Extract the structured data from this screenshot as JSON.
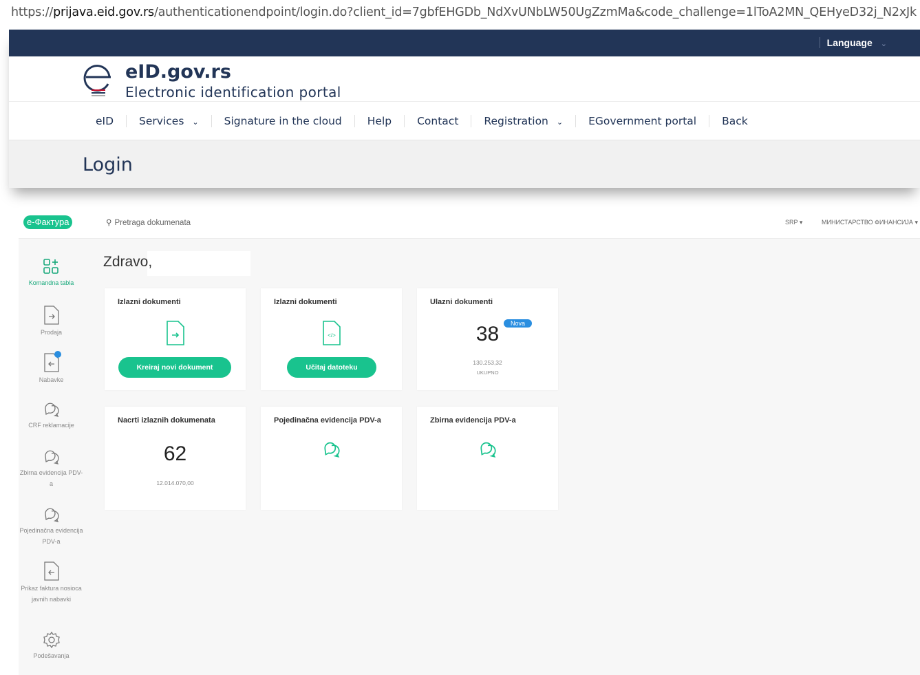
{
  "url": {
    "prefix": "https://",
    "domain": "prijava.eid.gov.rs",
    "rest": "/authenticationendpoint/login.do?client_id=7gbfEHGDb_NdXvUNbLW50UgZzmMa&code_challenge=1lToA2MN_QEHyeD32j_N2xJk"
  },
  "eid": {
    "language_label": "Language",
    "title": "eID.gov.rs",
    "subtitle": "Electronic identification portal",
    "nav": [
      "eID",
      "Services",
      "Signature in the cloud",
      "Help",
      "Contact",
      "Registration",
      "EGovernment portal",
      "Back"
    ],
    "page_title": "Login",
    "colors": {
      "navy": "#223557"
    }
  },
  "efaktura": {
    "logo_text": "е-Фактура",
    "search_placeholder": "Pretraga dokumenata",
    "lang": "SRP",
    "org": "МИНИСТАРСТВО ФИНАНСИЈА",
    "greeting": "Zdravo,",
    "sidebar": [
      {
        "label": "Komandna tabla",
        "icon": "dashboard-icon"
      },
      {
        "label": "Prodaja",
        "icon": "document-out-icon"
      },
      {
        "label": "Nabavke",
        "icon": "document-in-icon"
      },
      {
        "label": "CRF reklamacije",
        "icon": "chat-icon"
      },
      {
        "label": "Zbirna evidencija PDV-a",
        "icon": "chat-icon"
      },
      {
        "label": "Pojedinačna evidencija PDV-a",
        "icon": "chat-icon"
      },
      {
        "label": "Prikaz faktura nosioca javnih nabavki",
        "icon": "document-in-icon"
      },
      {
        "label": "Podešavanja",
        "icon": "gear-icon"
      }
    ],
    "cards": {
      "c1": {
        "title": "Izlazni dokumenti",
        "button": "Kreiraj novi dokument"
      },
      "c2": {
        "title": "Izlazni dokumenti",
        "button": "Učitaj datoteku"
      },
      "c3": {
        "title": "Ulazni dokumenti",
        "count": "38",
        "badge": "Nova",
        "amount": "130.253,32",
        "total_label": "UKUPNO"
      },
      "c4": {
        "title": "Nacrti izlaznih dokumenata",
        "count": "62",
        "amount": "12.014.070,00"
      },
      "c5": {
        "title": "Pojedinačna evidencija PDV-a"
      },
      "c6": {
        "title": "Zbirna evidencija PDV-a"
      }
    },
    "colors": {
      "accent": "#19c38e",
      "badge": "#2a8ee0"
    }
  }
}
